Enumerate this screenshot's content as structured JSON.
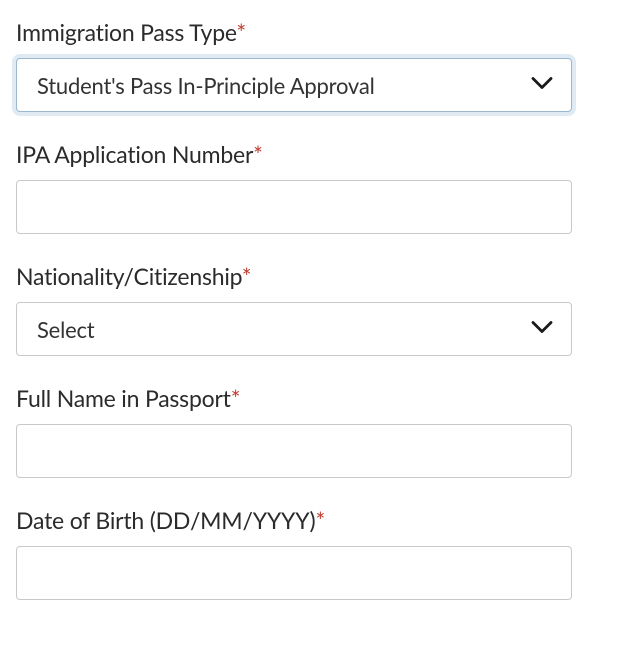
{
  "form": {
    "immigration_pass_type": {
      "label": "Immigration Pass Type",
      "required": "*",
      "value": "Student's Pass In-Principle Approval"
    },
    "ipa_application_number": {
      "label": "IPA Application Number",
      "required": "*",
      "value": ""
    },
    "nationality": {
      "label": "Nationality/Citizenship",
      "required": "*",
      "value": "Select"
    },
    "full_name": {
      "label": "Full Name in Passport",
      "required": "*",
      "value": ""
    },
    "date_of_birth": {
      "label": "Date of Birth (DD/MM/YYYY)",
      "required": "*",
      "value": ""
    }
  }
}
